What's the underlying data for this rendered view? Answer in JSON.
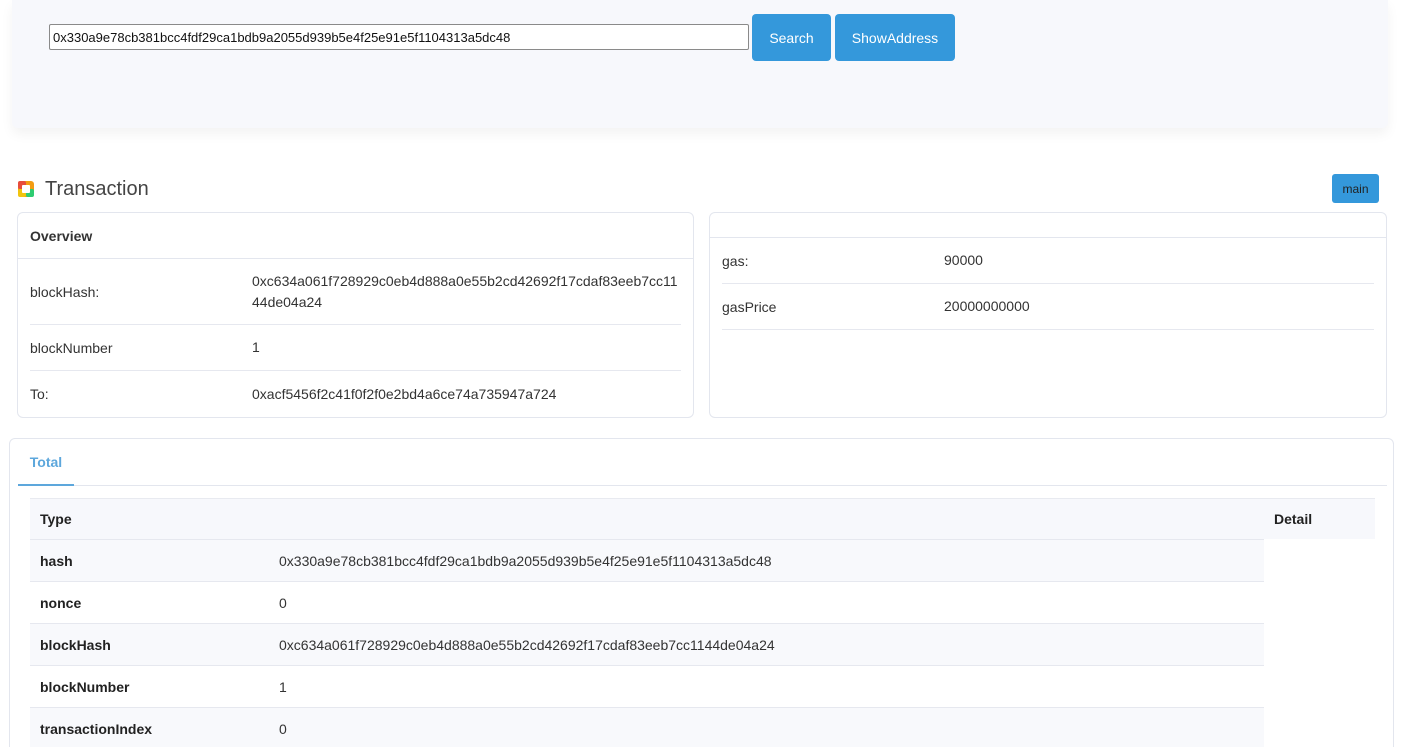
{
  "search": {
    "value": "0x330a9e78cb381bcc4fdf29ca1bdb9a2055d939b5e4f25e91e5f1104313a5dc48",
    "search_label": "Search",
    "show_address_label": "ShowAddress"
  },
  "header": {
    "title": "Transaction",
    "network_badge": "main"
  },
  "overview": {
    "title": "Overview",
    "rows": [
      {
        "key": "blockHash:",
        "value": "0xc634a061f728929c0eb4d888a0e55b2cd42692f17cdaf83eeb7cc1144de04a24"
      },
      {
        "key": "blockNumber",
        "value": "1"
      },
      {
        "key": "To:",
        "value": "0xacf5456f2c41f0f2f0e2bd4a6ce74a735947a724"
      }
    ]
  },
  "gas_card": {
    "rows": [
      {
        "key": "gas:",
        "value": "90000"
      },
      {
        "key": "gasPrice",
        "value": "20000000000"
      }
    ]
  },
  "total": {
    "tab_label": "Total",
    "columns": [
      "Type",
      "Detail"
    ],
    "rows": [
      {
        "key": "hash",
        "value": "0x330a9e78cb381bcc4fdf29ca1bdb9a2055d939b5e4f25e91e5f1104313a5dc48"
      },
      {
        "key": "nonce",
        "value": "0"
      },
      {
        "key": "blockHash",
        "value": "0xc634a061f728929c0eb4d888a0e55b2cd42692f17cdaf83eeb7cc1144de04a24"
      },
      {
        "key": "blockNumber",
        "value": "1"
      },
      {
        "key": "transactionIndex",
        "value": "0"
      }
    ]
  },
  "colors": {
    "accent": "#3498db",
    "tab_active": "#5da7dc"
  }
}
